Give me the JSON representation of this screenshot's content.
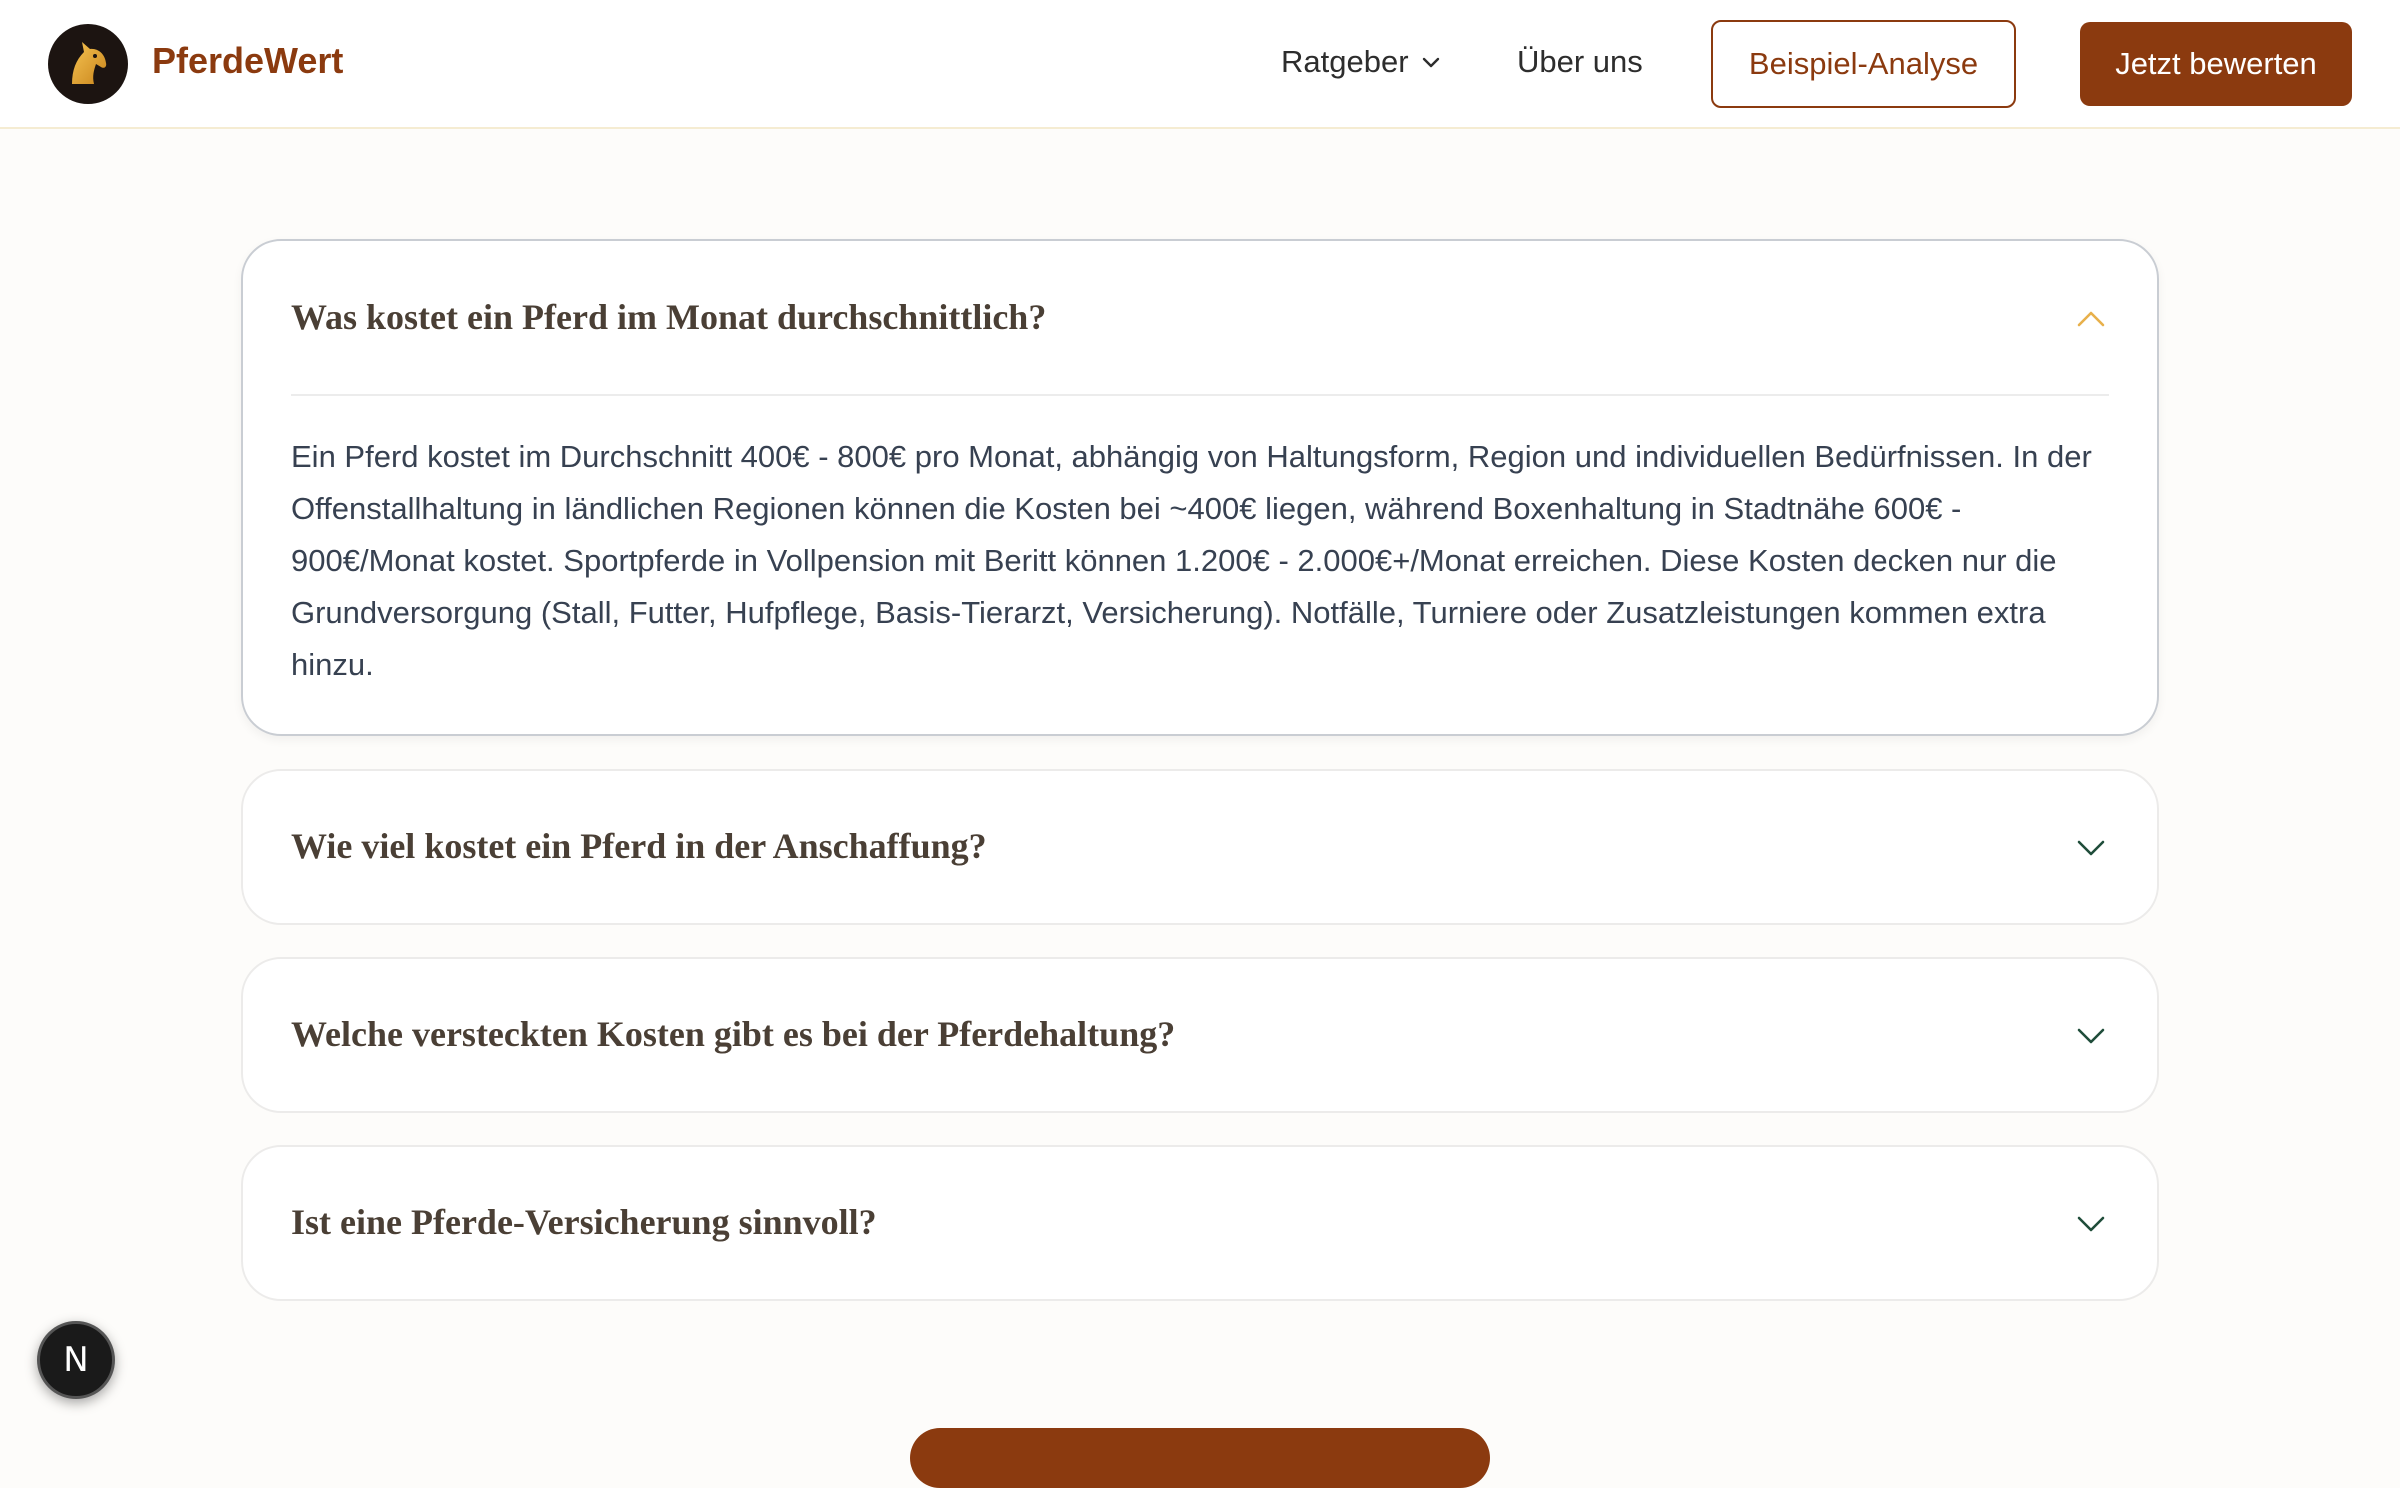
{
  "header": {
    "brand": "PferdeWert",
    "nav": {
      "ratgeber": "Ratgeber",
      "about": "Über uns"
    },
    "example_button": "Beispiel-Analyse",
    "cta_button": "Jetzt bewerten"
  },
  "faq": [
    {
      "question": "Was kostet ein Pferd im Monat durchschnittlich?",
      "answer": "Ein Pferd kostet im Durchschnitt 400€ - 800€ pro Monat, abhängig von Haltungsform, Region und individuellen Bedürfnissen. In der Offenstallhaltung in ländlichen Regionen können die Kosten bei ~400€ liegen, während Boxenhaltung in Stadtnähe 600€ - 900€/Monat kostet. Sportpferde in Vollpension mit Beritt können 1.200€ - 2.000€+/Monat erreichen. Diese Kosten decken nur die Grundversorgung (Stall, Futter, Hufpflege, Basis-Tierarzt, Versicherung). Notfälle, Turniere oder Zusatzleistungen kommen extra hinzu.",
      "expanded": true
    },
    {
      "question": "Wie viel kostet ein Pferd in der Anschaffung?",
      "expanded": false
    },
    {
      "question": "Welche versteckten Kosten gibt es bei der Pferdehaltung?",
      "expanded": false
    },
    {
      "question": "Ist eine Pferde-Versicherung sinnvoll?",
      "expanded": false
    }
  ],
  "dev_badge": "N",
  "colors": {
    "brand": "#8b3a0f",
    "chevron_open": "#e8b04a",
    "chevron_closed": "#1f4d3a"
  }
}
